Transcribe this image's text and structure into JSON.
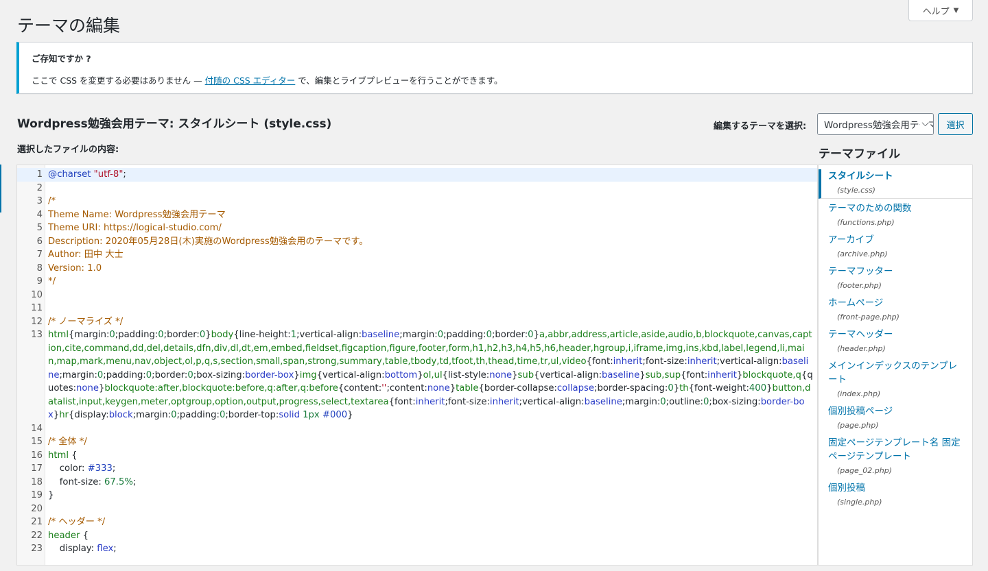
{
  "header": {
    "title": "テーマの編集",
    "help_label": "ヘルプ",
    "help_caret": "▼"
  },
  "notice": {
    "title": "ご存知ですか ?",
    "text_before": "ここで CSS を変更する必要はありません — ",
    "link": "付随の CSS エディター",
    "text_after": " で、編集とライブプレビューを行うことができます。"
  },
  "editor": {
    "heading": "Wordpress勉強会用テーマ: スタイルシート (style.css)",
    "content_label": "選択したファイルの内容:",
    "theme_select_label": "編集するテーマを選択:",
    "theme_select_value": "Wordpress勉強会用テーマ",
    "select_button": "選択",
    "chevron": "⌵"
  },
  "files_panel": {
    "heading": "テーマファイル",
    "items": [
      {
        "label": "スタイルシート",
        "file": "(style.css)"
      },
      {
        "label": "テーマのための関数",
        "file": "(functions.php)"
      },
      {
        "label": "アーカイブ",
        "file": "(archive.php)"
      },
      {
        "label": "テーマフッター",
        "file": "(footer.php)"
      },
      {
        "label": "ホームページ",
        "file": "(front-page.php)"
      },
      {
        "label": "テーマヘッダー",
        "file": "(header.php)"
      },
      {
        "label": "メインインデックスのテンプレート",
        "file": "(index.php)"
      },
      {
        "label": "個別投稿ページ",
        "file": "(page.php)"
      },
      {
        "label": "固定ページテンプレート名 固定ページテンプレート",
        "file": "(page_02.php)"
      },
      {
        "label": "個別投稿",
        "file": "(single.php)"
      }
    ]
  },
  "code_lines": [
    {
      "n": "1",
      "tokens": [
        [
          "atom",
          "@charset "
        ],
        [
          "str",
          "\"utf-8\""
        ],
        [
          "plain",
          ";"
        ]
      ]
    },
    {
      "n": "2",
      "tokens": []
    },
    {
      "n": "3",
      "tokens": [
        [
          "comment",
          "/*"
        ]
      ]
    },
    {
      "n": "4",
      "tokens": [
        [
          "comment",
          "Theme Name: Wordpress勉強会用テーマ"
        ]
      ]
    },
    {
      "n": "5",
      "tokens": [
        [
          "comment",
          "Theme URI: https://logical-studio.com/"
        ]
      ]
    },
    {
      "n": "6",
      "tokens": [
        [
          "comment",
          "Description: 2020年05月28日(木)実施のWordpress勉強会用のテーマです。"
        ]
      ]
    },
    {
      "n": "7",
      "tokens": [
        [
          "comment",
          "Author: 田中 大士"
        ]
      ]
    },
    {
      "n": "8",
      "tokens": [
        [
          "comment",
          "Version: 1.0"
        ]
      ]
    },
    {
      "n": "9",
      "tokens": [
        [
          "comment",
          "*/"
        ]
      ]
    },
    {
      "n": "10",
      "tokens": []
    },
    {
      "n": "11",
      "tokens": []
    },
    {
      "n": "12",
      "tokens": [
        [
          "comment",
          "/* ノーマライズ */"
        ]
      ]
    },
    {
      "n": "13",
      "tokens": [
        [
          "tag",
          "html"
        ],
        [
          "plain",
          "{margin:"
        ],
        [
          "num",
          "0"
        ],
        [
          "plain",
          ";padding:"
        ],
        [
          "num",
          "0"
        ],
        [
          "plain",
          ";border:"
        ],
        [
          "num",
          "0"
        ],
        [
          "plain",
          "}"
        ],
        [
          "tag",
          "body"
        ],
        [
          "plain",
          "{line-height:"
        ],
        [
          "num",
          "1"
        ],
        [
          "plain",
          ";vertical-align:"
        ],
        [
          "kw",
          "baseline"
        ],
        [
          "plain",
          ";margin:"
        ],
        [
          "num",
          "0"
        ],
        [
          "plain",
          ";padding:"
        ],
        [
          "num",
          "0"
        ],
        [
          "plain",
          ";border:"
        ],
        [
          "num",
          "0"
        ],
        [
          "plain",
          "}"
        ],
        [
          "tag",
          "a,abbr,address,article,aside,audio,b,blockquote,canvas,caption,cite,command,dd,del,details,dfn,div,dl,dt,em,embed,fieldset,figcaption,figure,footer,form,h1,h2,h3,h4,h5,h6,header,hgroup,i,iframe,img,ins,kbd,label,legend,li,main,map,mark,menu,nav,object,ol,p,q,s,section,small,span,strong,summary,table,tbody,td,tfoot,th,thead,time,tr,ul,video"
        ],
        [
          "plain",
          "{font:"
        ],
        [
          "kw",
          "inherit"
        ],
        [
          "plain",
          ";font-size:"
        ],
        [
          "kw",
          "inherit"
        ],
        [
          "plain",
          ";vertical-align:"
        ],
        [
          "kw",
          "baseline"
        ],
        [
          "plain",
          ";margin:"
        ],
        [
          "num",
          "0"
        ],
        [
          "plain",
          ";padding:"
        ],
        [
          "num",
          "0"
        ],
        [
          "plain",
          ";border:"
        ],
        [
          "num",
          "0"
        ],
        [
          "plain",
          ";box-sizing:"
        ],
        [
          "kw",
          "border-box"
        ],
        [
          "plain",
          "}"
        ],
        [
          "tag",
          "img"
        ],
        [
          "plain",
          "{vertical-align:"
        ],
        [
          "kw",
          "bottom"
        ],
        [
          "plain",
          "}"
        ],
        [
          "tag",
          "ol,ul"
        ],
        [
          "plain",
          "{list-style:"
        ],
        [
          "kw",
          "none"
        ],
        [
          "plain",
          "}"
        ],
        [
          "tag",
          "sub"
        ],
        [
          "plain",
          "{vertical-align:"
        ],
        [
          "kw",
          "baseline"
        ],
        [
          "plain",
          "}"
        ],
        [
          "tag",
          "sub,sup"
        ],
        [
          "plain",
          "{font:"
        ],
        [
          "kw",
          "inherit"
        ],
        [
          "plain",
          "}"
        ],
        [
          "tag",
          "blockquote,q"
        ],
        [
          "plain",
          "{quotes:"
        ],
        [
          "kw",
          "none"
        ],
        [
          "plain",
          "}"
        ],
        [
          "tag",
          "blockquote:after,blockquote:before,q:after,q:before"
        ],
        [
          "plain",
          "{content:"
        ],
        [
          "str",
          "''"
        ],
        [
          "plain",
          ";content:"
        ],
        [
          "kw",
          "none"
        ],
        [
          "plain",
          "}"
        ],
        [
          "tag",
          "table"
        ],
        [
          "plain",
          "{border-collapse:"
        ],
        [
          "kw",
          "collapse"
        ],
        [
          "plain",
          ";border-spacing:"
        ],
        [
          "num",
          "0"
        ],
        [
          "plain",
          "}"
        ],
        [
          "tag",
          "th"
        ],
        [
          "plain",
          "{font-weight:"
        ],
        [
          "num",
          "400"
        ],
        [
          "plain",
          "}"
        ],
        [
          "tag",
          "button,datalist,input,keygen,meter,optgroup,option,output,progress,select,textarea"
        ],
        [
          "plain",
          "{font:"
        ],
        [
          "kw",
          "inherit"
        ],
        [
          "plain",
          ";font-size:"
        ],
        [
          "kw",
          "inherit"
        ],
        [
          "plain",
          ";vertical-align:"
        ],
        [
          "kw",
          "baseline"
        ],
        [
          "plain",
          ";margin:"
        ],
        [
          "num",
          "0"
        ],
        [
          "plain",
          ";outline:"
        ],
        [
          "num",
          "0"
        ],
        [
          "plain",
          ";box-sizing:"
        ],
        [
          "kw",
          "border-box"
        ],
        [
          "plain",
          "}"
        ],
        [
          "tag",
          "hr"
        ],
        [
          "plain",
          "{display:"
        ],
        [
          "kw",
          "block"
        ],
        [
          "plain",
          ";margin:"
        ],
        [
          "num",
          "0"
        ],
        [
          "plain",
          ";padding:"
        ],
        [
          "num",
          "0"
        ],
        [
          "plain",
          ";border-top:"
        ],
        [
          "kw",
          "solid"
        ],
        [
          "plain",
          " "
        ],
        [
          "num",
          "1px"
        ],
        [
          "plain",
          " "
        ],
        [
          "atom",
          "#000"
        ],
        [
          "plain",
          "}"
        ]
      ]
    },
    {
      "n": "14",
      "tokens": []
    },
    {
      "n": "15",
      "tokens": [
        [
          "comment",
          "/* 全体 */"
        ]
      ]
    },
    {
      "n": "16",
      "tokens": [
        [
          "tag",
          "html"
        ],
        [
          "plain",
          " {"
        ]
      ]
    },
    {
      "n": "17",
      "tokens": [
        [
          "plain",
          "    color: "
        ],
        [
          "atom",
          "#333"
        ],
        [
          "plain",
          ";"
        ]
      ]
    },
    {
      "n": "18",
      "tokens": [
        [
          "plain",
          "    font-size: "
        ],
        [
          "num",
          "67.5%"
        ],
        [
          "plain",
          ";"
        ]
      ]
    },
    {
      "n": "19",
      "tokens": [
        [
          "plain",
          "}"
        ]
      ]
    },
    {
      "n": "20",
      "tokens": []
    },
    {
      "n": "21",
      "tokens": [
        [
          "comment",
          "/* ヘッダー */"
        ]
      ]
    },
    {
      "n": "22",
      "tokens": [
        [
          "tag",
          "header"
        ],
        [
          "plain",
          " {"
        ]
      ]
    },
    {
      "n": "23",
      "tokens": [
        [
          "plain",
          "    display: "
        ],
        [
          "kw",
          "flex"
        ],
        [
          "plain",
          ";"
        ]
      ]
    }
  ],
  "colors": {
    "accent": "#0073aa",
    "notice_border": "#00a0d2",
    "active_line": "#e8f2fe"
  }
}
